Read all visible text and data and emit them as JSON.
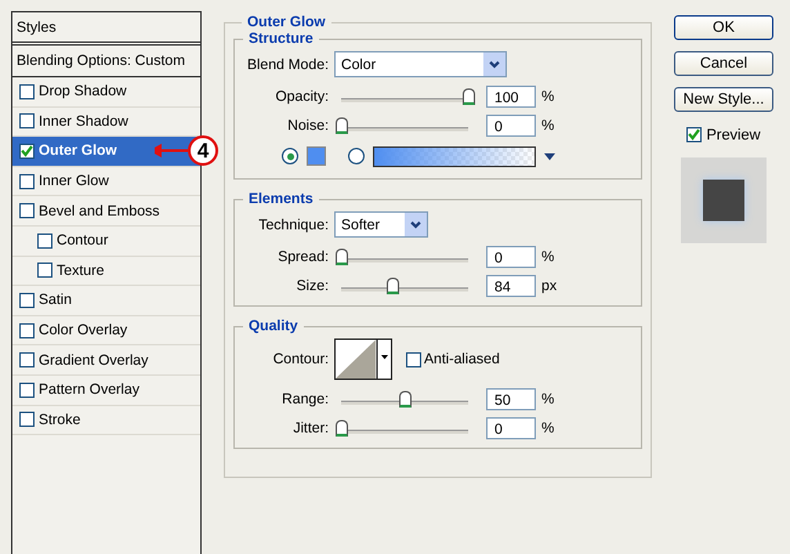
{
  "styles_panel": {
    "title": "Styles",
    "blending_options": "Blending Options: Custom",
    "items": [
      {
        "label": "Drop Shadow",
        "checked": false,
        "selected": false
      },
      {
        "label": "Inner Shadow",
        "checked": false,
        "selected": false
      },
      {
        "label": "Outer Glow",
        "checked": true,
        "selected": true
      },
      {
        "label": "Inner Glow",
        "checked": false,
        "selected": false
      },
      {
        "label": "Bevel and Emboss",
        "checked": false,
        "selected": false,
        "children": [
          {
            "label": "Contour",
            "checked": false,
            "selected": false
          },
          {
            "label": "Texture",
            "checked": false,
            "selected": false
          }
        ]
      },
      {
        "label": "Satin",
        "checked": false,
        "selected": false
      },
      {
        "label": "Color Overlay",
        "checked": false,
        "selected": false
      },
      {
        "label": "Gradient Overlay",
        "checked": false,
        "selected": false
      },
      {
        "label": "Pattern Overlay",
        "checked": false,
        "selected": false
      },
      {
        "label": "Stroke",
        "checked": false,
        "selected": false
      }
    ]
  },
  "callout": {
    "text": "4"
  },
  "outer_glow": {
    "title": "Outer Glow",
    "structure": {
      "title": "Structure",
      "blend_mode": {
        "label": "Blend Mode:",
        "value": "Color"
      },
      "sliders": [
        {
          "label": "Opacity:",
          "value": "100",
          "unit": "%",
          "level": 1
        },
        {
          "label": "Noise:",
          "value": "0",
          "unit": "%",
          "level": 0
        }
      ],
      "color_source": [
        {
          "kind": "swatch",
          "selected": true,
          "color": "#4f8ef0"
        },
        {
          "kind": "gradient",
          "selected": false,
          "color": "#4f8ef0"
        }
      ]
    },
    "elements": {
      "title": "Elements",
      "technique": {
        "label": "Technique:",
        "value": "Softer"
      },
      "sliders": [
        {
          "label": "Spread:",
          "value": "0",
          "unit": "%",
          "level": 0
        },
        {
          "label": "Size:",
          "value": "84",
          "unit": "px",
          "level": 0.4
        }
      ]
    },
    "quality": {
      "title": "Quality",
      "contour": {
        "label": "Contour:"
      },
      "anti_aliased": {
        "label": "Anti-aliased",
        "checked": false
      },
      "sliders": [
        {
          "label": "Range:",
          "value": "50",
          "unit": "%",
          "level": 0.5
        },
        {
          "label": "Jitter:",
          "value": "0",
          "unit": "%",
          "level": 0
        }
      ]
    }
  },
  "buttons": [
    {
      "label": "OK",
      "default": true
    },
    {
      "label": "Cancel",
      "default": false
    },
    {
      "label": "New Style...",
      "default": false
    }
  ],
  "preview": {
    "label": "Preview",
    "checked": true
  }
}
